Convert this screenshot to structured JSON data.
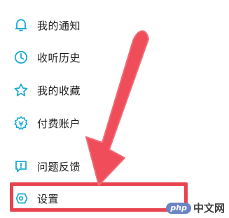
{
  "menu": {
    "items": [
      {
        "label": "我的通知",
        "icon": "bell-icon"
      },
      {
        "label": "收听历史",
        "icon": "clock-icon"
      },
      {
        "label": "我的收藏",
        "icon": "star-icon"
      },
      {
        "label": "付费账户",
        "icon": "gear-badge-icon"
      },
      {
        "label": "问题反馈",
        "icon": "feedback-icon"
      },
      {
        "label": "设置",
        "icon": "settings-tag-icon"
      }
    ]
  },
  "watermark": {
    "badge": "php",
    "text": "中文网"
  },
  "colors": {
    "icon": "#1aa9d1",
    "highlight": "#e8434f",
    "arrow": "#ee4d59",
    "text": "#1f1f1f"
  }
}
